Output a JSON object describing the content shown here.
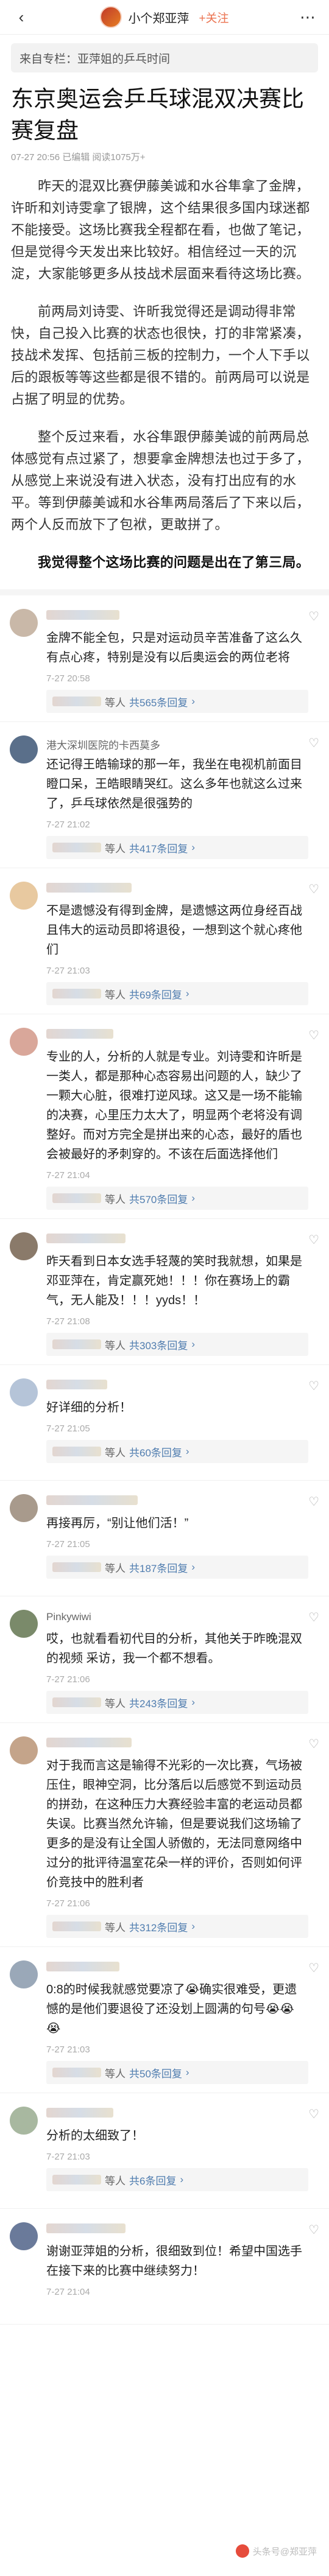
{
  "nav": {
    "back_icon": "chevron-left",
    "author": "小个郑亚萍",
    "follow_label": "+关注",
    "more_icon": "more-dots"
  },
  "source_tag": "来自专栏：亚萍姐的乒乓时间",
  "article": {
    "title": "东京奥运会乒乓球混双决赛比赛复盘",
    "meta": "07-27 20:56 已编辑 阅读1075万+",
    "paragraphs": [
      "昨天的混双比赛伊藤美诚和水谷隼拿了金牌，许昕和刘诗雯拿了银牌，这个结果很多国内球迷都不能接受。这场比赛我全程都在看，也做了笔记，但是觉得今天发出来比较好。相信经过一天的沉淀，大家能够更多从技战术层面来看待这场比赛。",
      "前两局刘诗雯、许昕我觉得还是调动得非常快，自己投入比赛的状态也很快，打的非常紧凑，技战术发挥、包括前三板的控制力，一个人下手以后的跟板等等这些都是很不错的。前两局可以说是占据了明显的优势。",
      "整个反过来看，水谷隼跟伊藤美诚的前两局总体感觉有点过紧了，想要拿金牌想法也过于多了，从感觉上来说没有进入状态，没有打出应有的水平。等到伊藤美诚和水谷隼两局落后了下来以后，两个人反而放下了包袱，更敢拼了。",
      "我觉得整个这场比赛的问题是出在了第三局。"
    ]
  },
  "comments": [
    {
      "text": "金牌不能全包，只是对运动员辛苦准备了这么久有点心疼，特别是没有以后奥运会的两位老将",
      "time": "7-27 20:58",
      "replies": "共565条回复"
    },
    {
      "name": "港大深圳医院的卡西莫多",
      "text": "还记得王皓输球的那一年，我坐在电视机前面目瞪口呆，王皓眼睛哭红。这么多年也就这么过来了，乒乓球依然是很强势的",
      "time": "7-27 21:02",
      "replies": "共417条回复"
    },
    {
      "text": "不是遗憾没有得到金牌，是遗憾这两位身经百战且伟大的运动员即将退役，一想到这个就心疼他们",
      "time": "7-27 21:03",
      "replies": "共69条回复"
    },
    {
      "text": "专业的人，分析的人就是专业。刘诗雯和许昕是一类人，都是那种心态容易出问题的人，缺少了一颗大心脏，很难打逆风球。这又是一场不能输的决赛，心里压力太大了，明显两个老将没有调整好。而对方完全是拼出来的心态，最好的盾也会被最好的矛刺穿的。不该在后面选择他们",
      "time": "7-27 21:04",
      "replies": "共570条回复"
    },
    {
      "text": "昨天看到日本女选手轻蔑的笑时我就想，如果是邓亚萍在，肯定赢死她！！！你在赛场上的霸气，无人能及！！！yyds！！",
      "time": "7-27 21:08",
      "replies": "共303条回复"
    },
    {
      "text": "好详细的分析！",
      "time": "7-27 21:05",
      "replies": "共60条回复"
    },
    {
      "text": "再接再厉，“别让他们活！”",
      "time": "7-27 21:05",
      "replies": "共187条回复"
    },
    {
      "name": "Pinkywiwi",
      "text": "哎，也就看看初代目的分析，其他关于昨晚混双的视频 采访，我一个都不想看。",
      "time": "7-27 21:06",
      "replies": "共243条回复"
    },
    {
      "text": "对于我而言这是输得不光彩的一次比赛，气场被压住，眼神空洞，比分落后以后感觉不到运动员的拼劲，在这种压力大赛经验丰富的老运动员都失误。比赛当然允许输，但是要说我们这场输了更多的是没有让全国人骄傲的，无法同意网络中过分的批评待温室花朵一样的评价，否则如何评价竞技中的胜利者",
      "time": "7-27 21:06",
      "replies": "共312条回复"
    },
    {
      "text": "0:8的时候我就感觉要凉了😭确实很难受，更遗憾的是他们要退役了还没划上圆满的句号😭😭😭",
      "time": "7-27 21:03",
      "replies": "共50条回复"
    },
    {
      "text": "分析的太细致了！",
      "time": "7-27 21:03",
      "replies": "共6条回复"
    },
    {
      "text": "谢谢亚萍姐的分析，很细致到位！希望中国选手在接下来的比赛中继续努力！",
      "time": "7-27 21:04",
      "replies": ""
    }
  ],
  "reply_prefix": "等人",
  "watermark": "头条号@郑亚萍",
  "colors": {
    "accent": "#eb7350",
    "link": "#507daf"
  }
}
